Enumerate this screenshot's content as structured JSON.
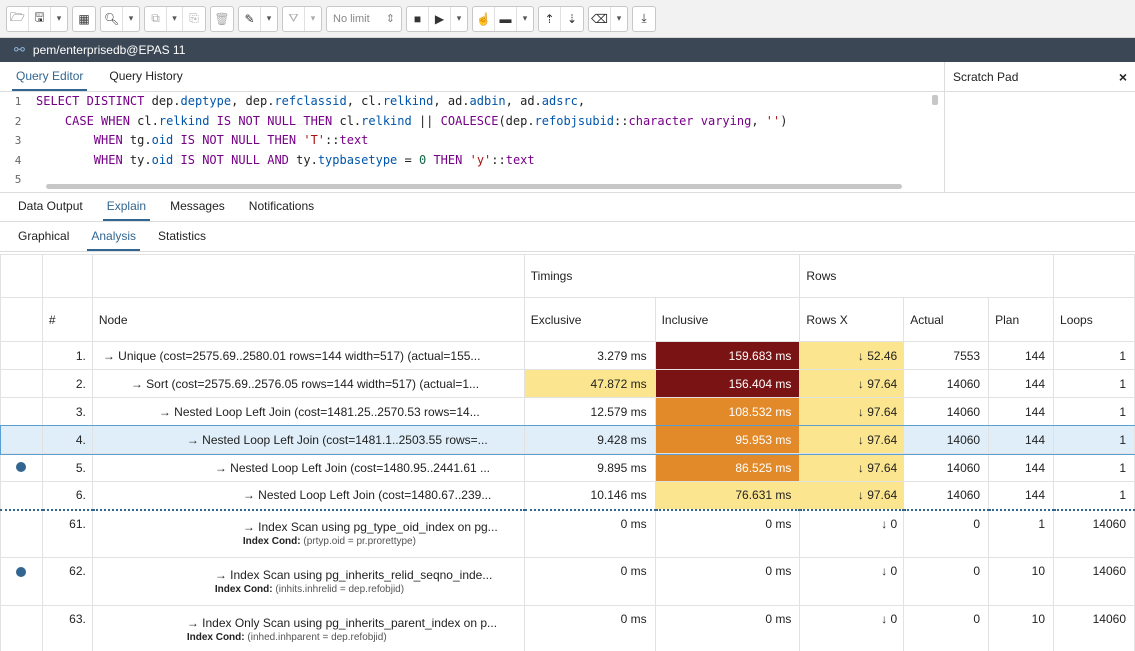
{
  "toolbar": {
    "limit_label": "No limit",
    "limit_arrows": "⇕"
  },
  "connection": {
    "icon": "connection-icon",
    "label": "pem/enterprisedb@EPAS 11"
  },
  "editor_tabs": [
    "Query Editor",
    "Query History"
  ],
  "scratch_pad": {
    "title": "Scratch Pad",
    "close": "×"
  },
  "code_lines": [
    {
      "num": "1"
    },
    {
      "num": "2"
    },
    {
      "num": "3"
    },
    {
      "num": "4"
    },
    {
      "num": "5"
    }
  ],
  "result_tabs": [
    "Data Output",
    "Explain",
    "Messages",
    "Notifications"
  ],
  "explain_tabs": [
    "Graphical",
    "Analysis",
    "Statistics"
  ],
  "table": {
    "group_headers": {
      "timings": "Timings",
      "rows": "Rows"
    },
    "columns": {
      "index": "#",
      "node": "Node",
      "exclusive": "Exclusive",
      "inclusive": "Inclusive",
      "rows_x": "Rows X",
      "actual": "Actual",
      "plan": "Plan",
      "loops": "Loops"
    },
    "rows": [
      {
        "marker": false,
        "idx": "1.",
        "node": "→ Unique (cost=2575.69..2580.01 rows=144 width=517) (actual=155...",
        "exclusive": "3.279 ms",
        "inclusive": "159.683 ms",
        "rows_x": "↓ 52.46",
        "actual": "7553",
        "plan": "144",
        "loops": "1"
      },
      {
        "marker": false,
        "idx": "2.",
        "node": "→ Sort (cost=2575.69..2576.05 rows=144 width=517) (actual=1...",
        "exclusive": "47.872 ms",
        "inclusive": "156.404 ms",
        "rows_x": "↓ 97.64",
        "actual": "14060",
        "plan": "144",
        "loops": "1"
      },
      {
        "marker": false,
        "idx": "3.",
        "node": "→ Nested Loop Left Join (cost=1481.25..2570.53 rows=14...",
        "exclusive": "12.579 ms",
        "inclusive": "108.532 ms",
        "rows_x": "↓ 97.64",
        "actual": "14060",
        "plan": "144",
        "loops": "1"
      },
      {
        "marker": false,
        "idx": "4.",
        "node": "→ Nested Loop Left Join (cost=1481.1..2503.55 rows=...",
        "exclusive": "9.428 ms",
        "inclusive": "95.953 ms",
        "rows_x": "↓ 97.64",
        "actual": "14060",
        "plan": "144",
        "loops": "1"
      },
      {
        "marker": true,
        "idx": "5.",
        "node": "→ Nested Loop Left Join (cost=1480.95..2441.61 ...",
        "exclusive": "9.895 ms",
        "inclusive": "86.525 ms",
        "rows_x": "↓ 97.64",
        "actual": "14060",
        "plan": "144",
        "loops": "1"
      },
      {
        "marker": false,
        "idx": "6.",
        "node": "→ Nested Loop Left Join (cost=1480.67..239...",
        "exclusive": "10.146 ms",
        "inclusive": "76.631 ms",
        "rows_x": "↓ 97.64",
        "actual": "14060",
        "plan": "144",
        "loops": "1"
      },
      {
        "marker": false,
        "idx": "61.",
        "node": "→ Index Scan using pg_type_oid_index on pg...",
        "cond_label": "Index Cond:",
        "cond": "(prtyp.oid = pr.prorettype)",
        "exclusive": "0 ms",
        "inclusive": "0 ms",
        "rows_x": "↓ 0",
        "actual": "0",
        "plan": "1",
        "loops": "14060"
      },
      {
        "marker": true,
        "idx": "62.",
        "node": "→ Index Scan using pg_inherits_relid_seqno_inde...",
        "cond_label": "Index Cond:",
        "cond": "(inhits.inhrelid = dep.refobjid)",
        "exclusive": "0 ms",
        "inclusive": "0 ms",
        "rows_x": "↓ 0",
        "actual": "0",
        "plan": "10",
        "loops": "14060"
      },
      {
        "marker": false,
        "idx": "63.",
        "node": "→ Index Only Scan using pg_inherits_parent_index on p...",
        "cond_label": "Index Cond:",
        "cond": "(inhed.inhparent = dep.refobjid)",
        "exclusive": "0 ms",
        "inclusive": "0 ms",
        "rows_x": "↓ 0",
        "actual": "0",
        "plan": "10",
        "loops": "14060"
      }
    ]
  },
  "colors": {
    "accent": "#326690",
    "connection_bar": "#3b4754",
    "heat_dark": "#7a1313",
    "heat_orange": "#e28a2a",
    "heat_yellow": "#fbe58e",
    "selection": "#dfeef8"
  }
}
